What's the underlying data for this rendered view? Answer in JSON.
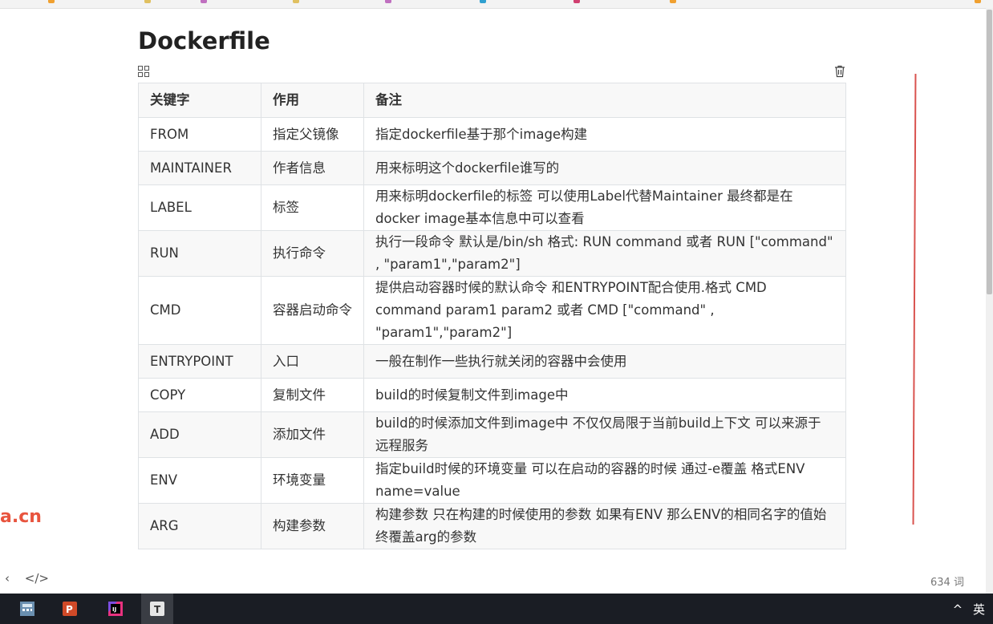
{
  "document": {
    "title": "Dockerfile"
  },
  "table": {
    "headers": [
      "关键字",
      "作用",
      "备注"
    ],
    "rows": [
      [
        "FROM",
        "指定父镜像",
        "指定dockerfile基于那个image构建"
      ],
      [
        "MAINTAINER",
        "作者信息",
        "用来标明这个dockerfile谁写的"
      ],
      [
        "LABEL",
        "标签",
        "用来标明dockerfile的标签 可以使用Label代替Maintainer 最终都是在docker image基本信息中可以查看"
      ],
      [
        "RUN",
        "执行命令",
        "执行一段命令 默认是/bin/sh 格式: RUN command 或者 RUN [\"command\" , \"param1\",\"param2\"]"
      ],
      [
        "CMD",
        "容器启动命令",
        "提供启动容器时候的默认命令 和ENTRYPOINT配合使用.格式 CMD command param1 param2 或者 CMD [\"command\" , \"param1\",\"param2\"]"
      ],
      [
        "ENTRYPOINT",
        "入口",
        "一般在制作一些执行就关闭的容器中会使用"
      ],
      [
        "COPY",
        "复制文件",
        "build的时候复制文件到image中"
      ],
      [
        "ADD",
        "添加文件",
        "build的时候添加文件到image中 不仅仅局限于当前build上下文 可以来源于远程服务"
      ],
      [
        "ENV",
        "环境变量",
        "指定build时候的环境变量 可以在启动的容器的时候 通过-e覆盖 格式ENV name=value"
      ],
      [
        "ARG",
        "构建参数",
        "构建参数 只在构建的时候使用的参数 如果有ENV 那么ENV的相同名字的值始终覆盖arg的参数"
      ]
    ]
  },
  "watermark": "a.cn",
  "status_bar": {
    "back_glyph": "‹",
    "source_glyph": "</>",
    "word_count": "634 词"
  },
  "taskbar": {
    "active_app_label": "T",
    "tray_chevron": "^",
    "ime_label": "英"
  },
  "colors": {
    "accent_red": "#d9534f",
    "watermark": "#e8543e",
    "taskbar_bg": "#1a1d24"
  }
}
